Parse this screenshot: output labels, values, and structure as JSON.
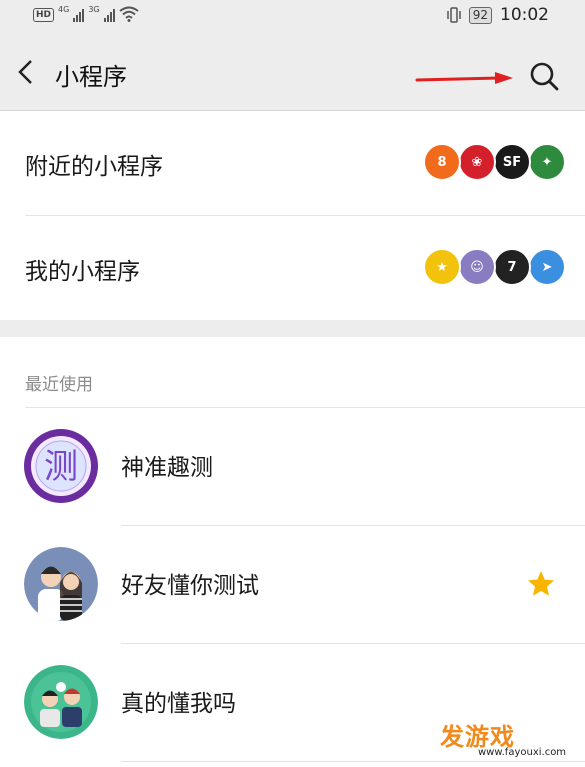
{
  "status_bar": {
    "hd": "HD",
    "net1": "4G",
    "net2": "3G",
    "battery": "92",
    "time": "10:02"
  },
  "header": {
    "title": "小程序",
    "back_icon": "chevron-left-icon",
    "search_icon": "search-icon",
    "arrow_color": "#e02020"
  },
  "menu": {
    "nearby_label": "附近的小程序",
    "mine_label": "我的小程序"
  },
  "nearby_icons": [
    {
      "name": "orange-logo",
      "color": "#f26b1d",
      "glyph": "8"
    },
    {
      "name": "red-logo",
      "color": "#d4202b",
      "glyph": "❀"
    },
    {
      "name": "sf-logo",
      "color": "#1a1a1a",
      "glyph": "SF"
    },
    {
      "name": "green-logo",
      "color": "#2e8b3e",
      "glyph": "✦"
    }
  ],
  "mine_icons": [
    {
      "name": "yellow-logo",
      "color": "#f2c20c",
      "glyph": "★"
    },
    {
      "name": "couple-logo",
      "color": "#8a7cc0",
      "glyph": "☺"
    },
    {
      "name": "seven-logo",
      "color": "#222222",
      "glyph": "7"
    },
    {
      "name": "plane-logo",
      "color": "#3b8fe0",
      "glyph": "➤"
    }
  ],
  "recent": {
    "header": "最近使用",
    "items": [
      {
        "name": "神准趣测",
        "icon_text": "测",
        "starred": false
      },
      {
        "name": "好友懂你测试",
        "starred": true
      },
      {
        "name": "真的懂我吗",
        "starred": false
      }
    ]
  },
  "watermark": {
    "big": "发游戏",
    "small": "www.fayouxi.com"
  },
  "colors": {
    "background": "#ededed",
    "card": "#ffffff",
    "star": "#f7b500",
    "accent_purple": "#6b2ca0"
  }
}
